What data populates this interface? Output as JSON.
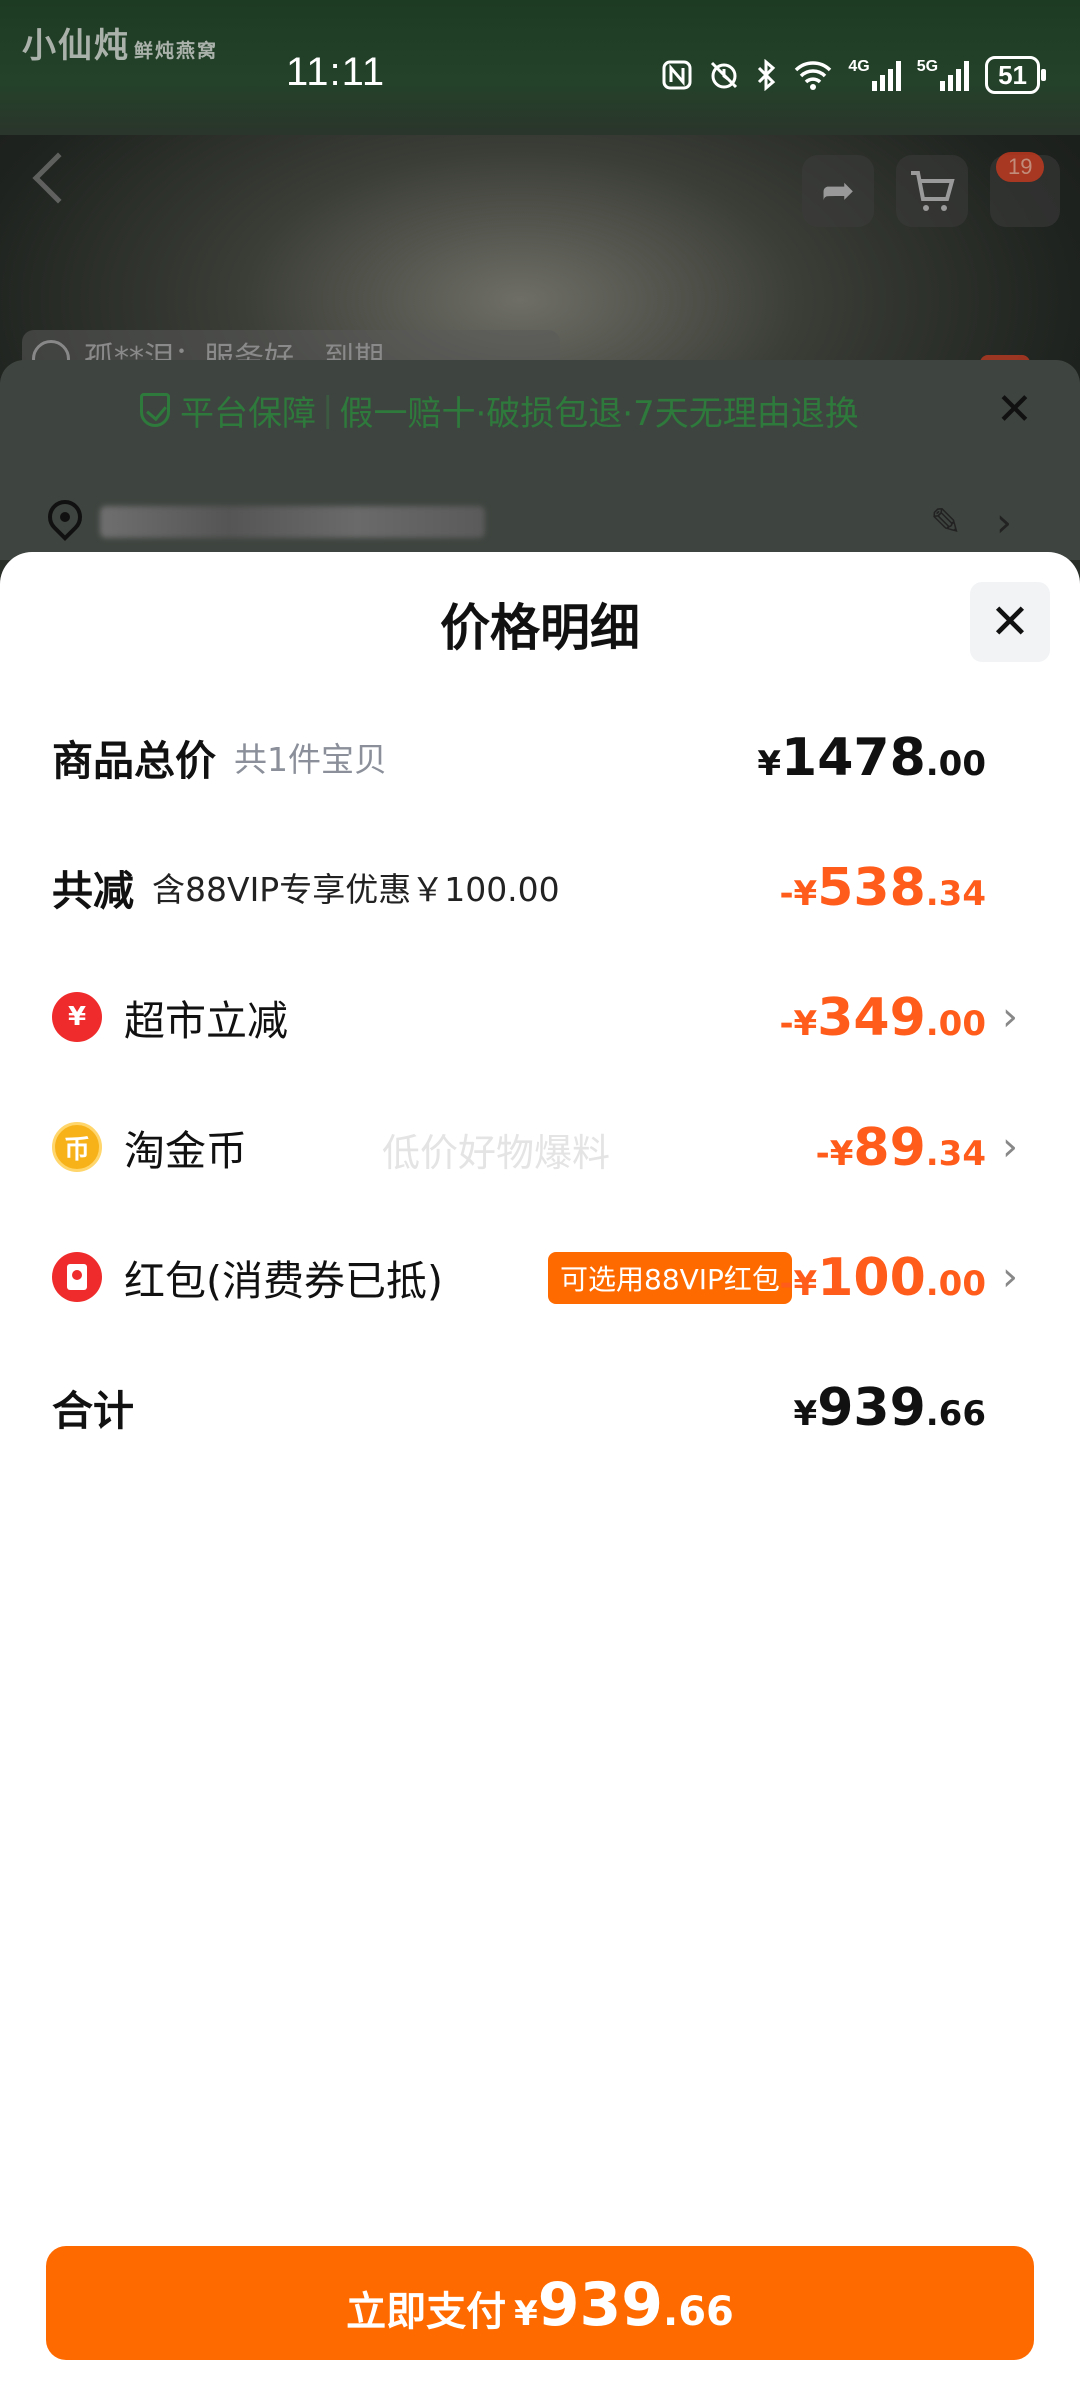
{
  "status_bar": {
    "time": "11:11",
    "net1": "4G",
    "net2": "5G",
    "battery": "51"
  },
  "background": {
    "shop_logo": "小仙炖",
    "shop_logo_sub": "鲜炖燕窝",
    "cart_badge": "19",
    "review_snippet": "孤**泪：服务好，到期"
  },
  "guarantee": {
    "prefix": "平台保障",
    "items": "假一赔十·破损包退·7天无理由退换"
  },
  "sheet": {
    "title": "价格明细",
    "rows": {
      "total": {
        "label": "商品总价",
        "sub": "共1件宝贝",
        "yen": "¥",
        "int": "1478",
        "dec": ".00"
      },
      "discount": {
        "label": "共减",
        "sub": "含88VIP专享优惠￥100.00",
        "yen": "-¥",
        "int": "538",
        "dec": ".34"
      },
      "market": {
        "label": "超市立减",
        "icon_text": "¥",
        "yen": "-¥",
        "int": "349",
        "dec": ".00"
      },
      "coin": {
        "label": "淘金币",
        "icon_text": "币",
        "yen": "-¥",
        "int": "89",
        "dec": ".34"
      },
      "hongbao": {
        "label": "红包(消费券已抵)",
        "tag": "可选用88VIP红包",
        "yen": "-¥",
        "int": "100",
        "dec": ".00"
      },
      "sum": {
        "label": "合计",
        "yen": "¥",
        "int": "939",
        "dec": ".66"
      }
    },
    "watermark": "低价好物爆料"
  },
  "pay_button": {
    "label": "立即支付",
    "yen": "¥",
    "int": "939",
    "dec": ".66"
  },
  "colors": {
    "accent": "#ff6a00",
    "discount": "#ff5b1a",
    "guarantee_green": "#2e7a3c"
  }
}
